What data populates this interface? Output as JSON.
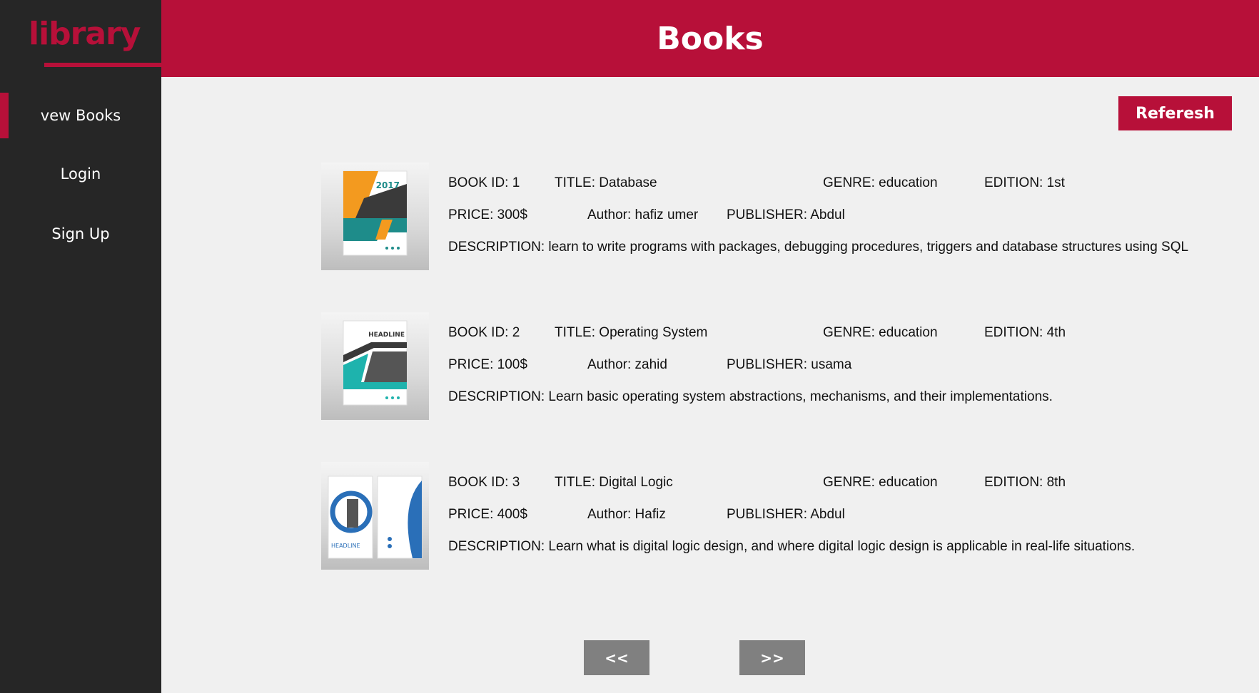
{
  "sidebar": {
    "logo": "library",
    "nav": [
      {
        "label": "vew Books"
      },
      {
        "label": "Login"
      },
      {
        "label": "Sign Up"
      }
    ]
  },
  "header": {
    "title": "Books"
  },
  "toolbar": {
    "refresh_label": "Referesh"
  },
  "books": [
    {
      "id": "BOOK ID: 1",
      "title": "TITLE: Database",
      "genre": "GENRE: education",
      "edition": "EDITION: 1st",
      "price": "PRICE: 300$",
      "author": "Author: hafiz umer",
      "publisher": "PUBLISHER: Abdul",
      "description": "DESCRIPTION: learn to write programs with packages, debugging procedures, triggers and database structures using SQL",
      "cover_text": "2017"
    },
    {
      "id": "BOOK ID: 2",
      "title": "TITLE: Operating System",
      "genre": "GENRE: education",
      "edition": "EDITION: 4th",
      "price": "PRICE: 100$",
      "author": "Author: zahid",
      "publisher": "PUBLISHER: usama",
      "description": "DESCRIPTION: Learn basic operating system abstractions, mechanisms, and their implementations.",
      "cover_text": "HEADLINE"
    },
    {
      "id": "BOOK ID: 3",
      "title": "TITLE: Digital Logic",
      "genre": "GENRE: education",
      "edition": "EDITION: 8th",
      "price": "PRICE: 400$",
      "author": "Author: Hafiz",
      "publisher": "PUBLISHER: Abdul",
      "description": "DESCRIPTION: Learn what is digital logic design, and where digital logic design is applicable in real-life situations.",
      "cover_text": "HEADLINE"
    }
  ],
  "pagination": {
    "prev_label": "<<",
    "next_label": ">>"
  },
  "colors": {
    "accent": "#b71039",
    "sidebar": "#262626",
    "content_bg": "#f0f0f0",
    "pager": "#808080"
  }
}
